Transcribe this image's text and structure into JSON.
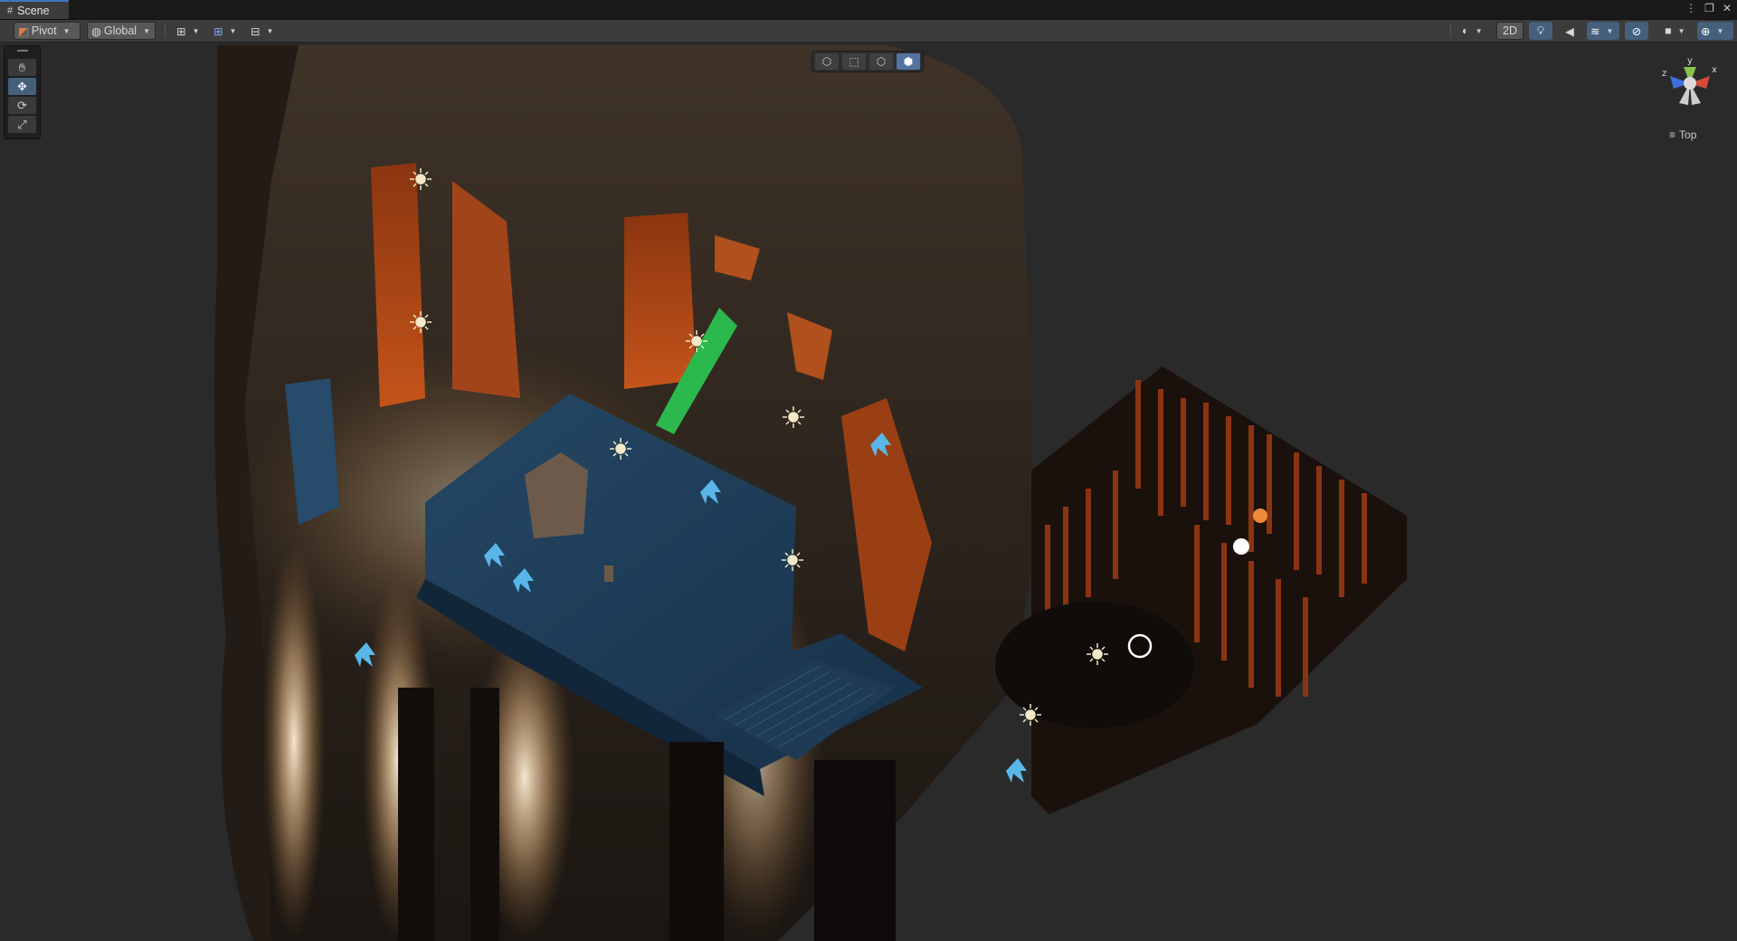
{
  "window": {
    "tab_title": "Scene",
    "controls": [
      "⋮",
      "❐",
      "✕"
    ]
  },
  "toolbar": {
    "pivot_label": "Pivot",
    "global_label": "Global",
    "mode_2d_label": "2D"
  },
  "gizmo": {
    "view_label": "Top",
    "axes": [
      "y",
      "z",
      "x"
    ]
  },
  "tools": [
    "hand-tool",
    "move-tool",
    "rotate-tool",
    "scale-tool"
  ],
  "colors": {
    "accent": "#46607c",
    "light_icon": "#f3e9c9",
    "probe_icon": "#5ab6e8",
    "lava": "#c05016",
    "floor": "#1c3a52"
  }
}
